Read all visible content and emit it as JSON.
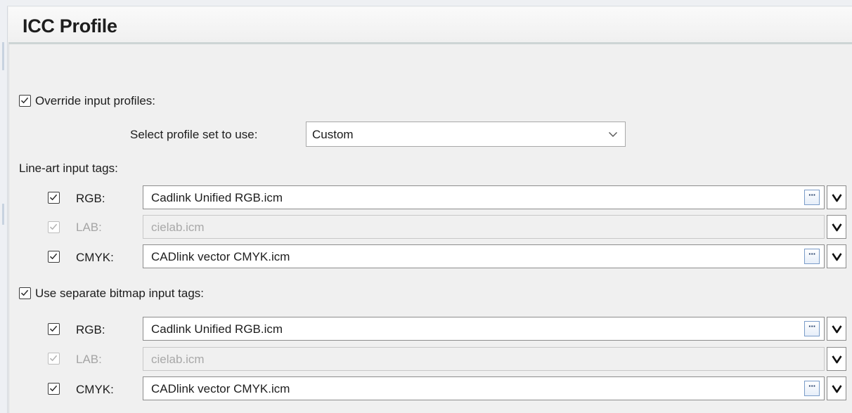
{
  "header": {
    "title": "ICC Profile"
  },
  "override": {
    "label": "Override input profiles:",
    "checked": true
  },
  "profile_set": {
    "label": "Select profile set to use:",
    "value": "Custom"
  },
  "line_art": {
    "heading": "Line-art input tags:",
    "rows": [
      {
        "label": "RGB:",
        "value": "Cadlink Unified RGB.icm",
        "checked": true,
        "enabled": true
      },
      {
        "label": "LAB:",
        "value": "cielab.icm",
        "checked": true,
        "enabled": false
      },
      {
        "label": "CMYK:",
        "value": "CADlink vector CMYK.icm",
        "checked": true,
        "enabled": true
      }
    ]
  },
  "bitmap": {
    "label": "Use separate bitmap input tags:",
    "checked": true,
    "rows": [
      {
        "label": "RGB:",
        "value": "Cadlink Unified RGB.icm",
        "checked": true,
        "enabled": true
      },
      {
        "label": "LAB:",
        "value": "cielab.icm",
        "checked": true,
        "enabled": false
      },
      {
        "label": "CMYK:",
        "value": "CADlink vector CMYK.icm",
        "checked": true,
        "enabled": true
      }
    ]
  },
  "browse_glyph": "···",
  "icons": {
    "check": "check-icon",
    "dropdown": "chevron-down-icon",
    "browse": "ellipsis-icon"
  }
}
